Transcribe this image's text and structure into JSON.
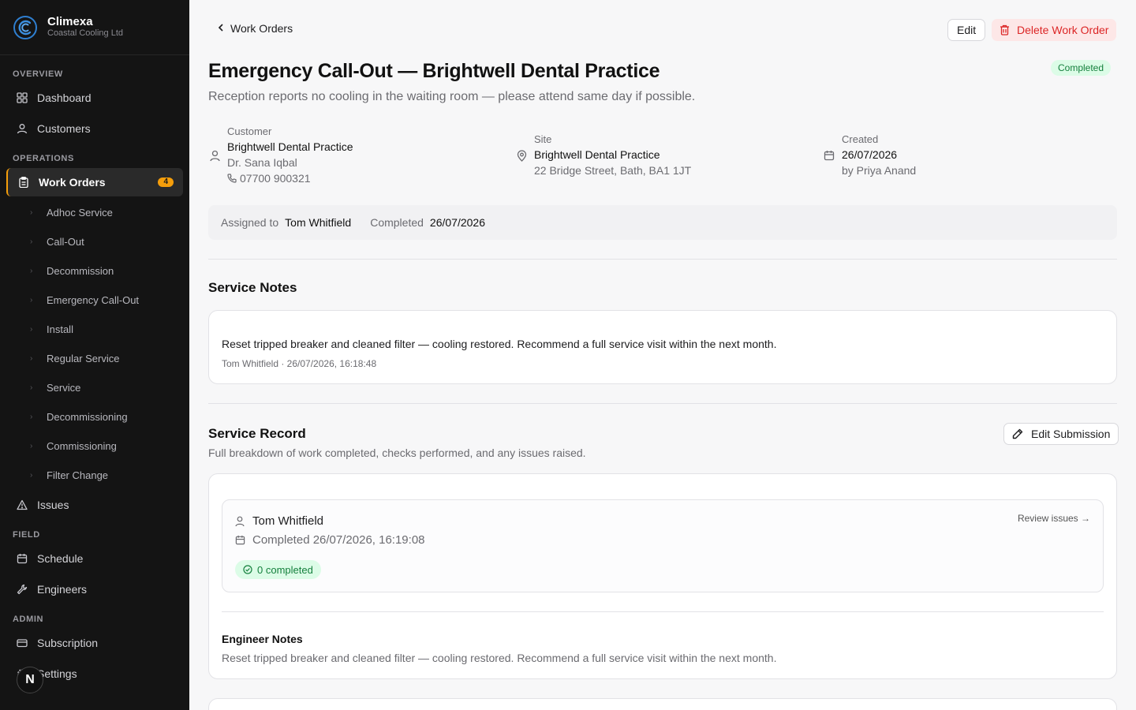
{
  "brand": {
    "name": "Climexa",
    "company": "Coastal Cooling Ltd"
  },
  "sidebar": {
    "sections": {
      "overview": "OVERVIEW",
      "operations": "OPERATIONS",
      "field": "FIELD",
      "admin": "ADMIN"
    },
    "items": {
      "dashboard": "Dashboard",
      "customers": "Customers",
      "work_orders": "Work Orders",
      "work_orders_badge": "4",
      "issues": "Issues",
      "schedule": "Schedule",
      "engineers": "Engineers",
      "subscription": "Subscription",
      "settings": "Settings"
    },
    "sub_items": [
      "Adhoc Service",
      "Call-Out",
      "Decommission",
      "Emergency Call-Out",
      "Install",
      "Regular Service",
      "Service",
      "Decommissioning",
      "Commissioning",
      "Filter Change"
    ],
    "avatar_letter": "N"
  },
  "header": {
    "back_label": "Work Orders",
    "edit_label": "Edit",
    "delete_label": "Delete Work Order",
    "status": "Completed",
    "title": "Emergency Call-Out — Brightwell Dental Practice",
    "subtitle": "Reception reports no cooling in the waiting room — please attend same day if possible."
  },
  "info": {
    "customer": {
      "label": "Customer",
      "name": "Brightwell Dental Practice",
      "contact": "Dr. Sana Iqbal",
      "phone": "07700 900321"
    },
    "site": {
      "label": "Site",
      "name": "Brightwell Dental Practice",
      "address": "22 Bridge Street, Bath, BA1 1JT"
    },
    "created": {
      "label": "Created",
      "date": "26/07/2026",
      "by": "by Priya Anand"
    }
  },
  "assignment": {
    "assigned_label": "Assigned to",
    "assigned_value": "Tom Whitfield",
    "completed_label": "Completed",
    "completed_value": "26/07/2026"
  },
  "service_notes": {
    "title": "Service Notes",
    "text": "Reset tripped breaker and cleaned filter — cooling restored. Recommend a full service visit within the next month.",
    "meta": "Tom Whitfield · 26/07/2026, 16:18:48"
  },
  "service_record": {
    "title": "Service Record",
    "description": "Full breakdown of work completed, checks performed, and any issues raised.",
    "edit_label": "Edit Submission",
    "engineer": "Tom Whitfield",
    "completed_at": "Completed 26/07/2026, 16:19:08",
    "review_link": "Review issues →",
    "completed_count": "0 completed",
    "engineer_notes_title": "Engineer Notes",
    "engineer_notes": "Reset tripped breaker and cleaned filter — cooling restored. Recommend a full service visit within the next month."
  },
  "colors": {
    "accent": "#f59e0b",
    "sidebar_bg": "#141414",
    "success_bg": "#dcfce7",
    "success_text": "#15803d",
    "danger_bg": "#fde7e7",
    "danger_text": "#dc2626"
  }
}
